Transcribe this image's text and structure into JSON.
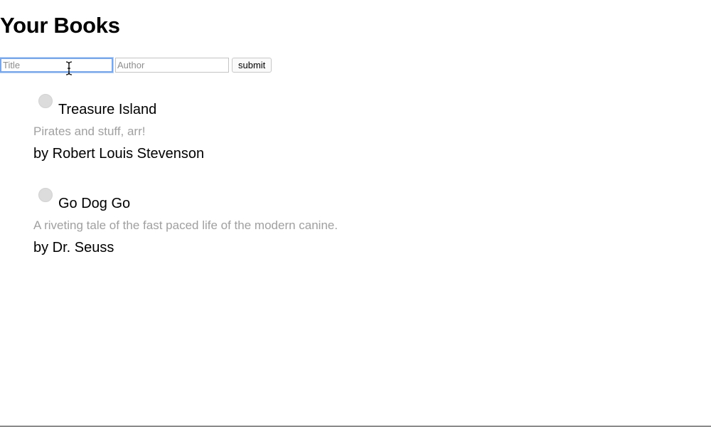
{
  "heading": "Your Books",
  "form": {
    "title_placeholder": "Title",
    "author_placeholder": "Author",
    "submit_label": "submit"
  },
  "books": [
    {
      "title": "Treasure Island",
      "description": "Pirates and stuff, arr!",
      "author": "by Robert Louis Stevenson"
    },
    {
      "title": "Go Dog Go",
      "description": "A riveting tale of the fast paced life of the modern canine.",
      "author": "by Dr. Seuss"
    }
  ]
}
